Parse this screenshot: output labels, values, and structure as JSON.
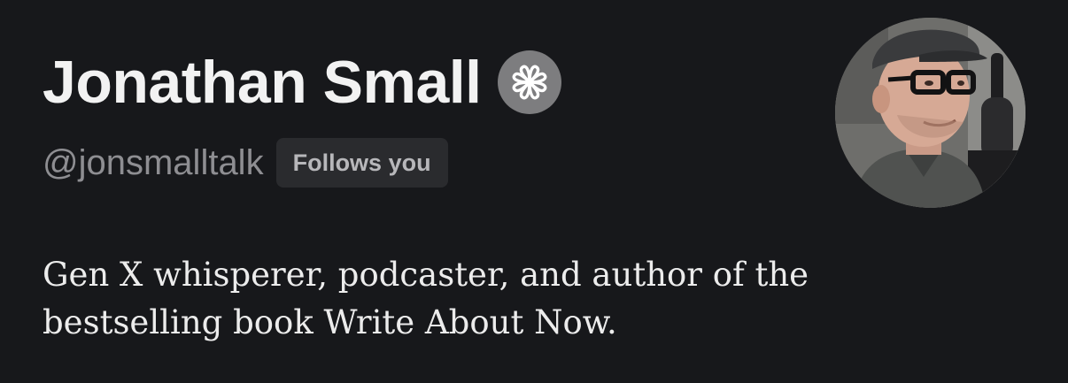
{
  "profile": {
    "display_name": "Jonathan Small",
    "handle": "@jonsmalltalk",
    "follows_badge": "Follows you",
    "bio": "Gen X whisperer, podcaster, and author of the bestselling book Write About Now.",
    "verified_icon": "verified-badge-icon",
    "avatar_icon": "profile-photo"
  },
  "colors": {
    "background": "#17181b",
    "name_text": "#f2f2f2",
    "handle_text": "#8e8e92",
    "badge_bg": "#2a2b2e",
    "badge_text": "#b7b7ba",
    "verified_bg": "#7d7d7f"
  }
}
